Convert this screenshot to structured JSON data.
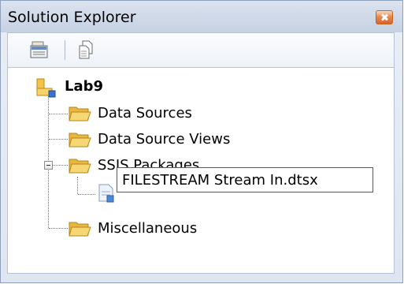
{
  "window": {
    "title": "Solution Explorer"
  },
  "toolbar": {
    "buttons": [
      {
        "icon": "properties-icon"
      },
      {
        "icon": "show-all-files-icon"
      }
    ]
  },
  "tree": {
    "root": {
      "label": "Lab9",
      "icon": "solution-project-icon"
    },
    "items": [
      {
        "label": "Data Sources",
        "icon": "folder-icon"
      },
      {
        "label": "Data Source Views",
        "icon": "folder-icon"
      },
      {
        "label": "SSIS Packages",
        "icon": "folder-icon",
        "expanded": true
      },
      {
        "label": "Miscellaneous",
        "icon": "folder-icon"
      }
    ],
    "package_item": {
      "icon": "dtsx-package-icon",
      "edit_value": "FILESTREAM Stream In.dtsx"
    }
  },
  "colors": {
    "folder": "#f3c85a",
    "title_bg": "#cfd9e8",
    "close_button": "#e07a44"
  }
}
